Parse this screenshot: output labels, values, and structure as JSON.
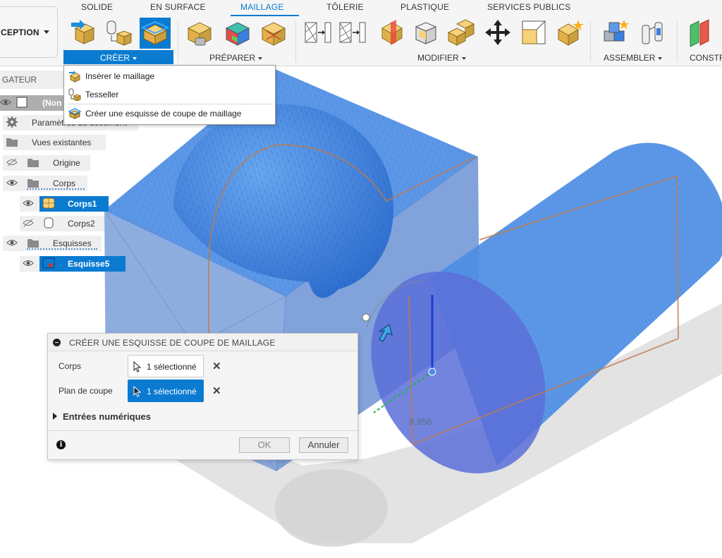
{
  "ribbon": {
    "workspace": {
      "label": "CEPTION"
    },
    "tabs": [
      {
        "label": "SOLIDE",
        "active": false
      },
      {
        "label": "EN SURFACE",
        "active": false
      },
      {
        "label": "MAILLAGE",
        "active": true
      },
      {
        "label": "TÔLERIE",
        "active": false
      },
      {
        "label": "PLASTIQUE",
        "active": false
      },
      {
        "label": "SERVICES PUBLICS",
        "active": false
      }
    ],
    "groups": {
      "creer": "CRÉER",
      "preparer": "PRÉPARER",
      "modifier": "MODIFIER",
      "assembler": "ASSEMBLER",
      "construire": "CONSTR"
    },
    "accent_color": "#0a7bd1"
  },
  "creer_menu": {
    "items": [
      {
        "label": "Insérer le maillage",
        "icon": "insert-mesh-icon"
      },
      {
        "label": "Tesseller",
        "icon": "tessellate-icon"
      },
      {
        "label": "Créer une esquisse de coupe de maillage",
        "icon": "mesh-section-sketch-icon"
      }
    ]
  },
  "browser": {
    "header": "GATEUR",
    "root": "(Non",
    "items": [
      {
        "label": "Paramètres du document",
        "icon": "gear-icon"
      },
      {
        "label": "Vues existantes",
        "icon": "folder-icon"
      },
      {
        "label": "Origine",
        "icon": "folder-icon"
      },
      {
        "label": "Corps",
        "icon": "folder-icon"
      },
      {
        "label": "Corps1",
        "icon": "mesh-body-icon",
        "selected": true
      },
      {
        "label": "Corps2",
        "icon": "body-icon"
      },
      {
        "label": "Esquisses",
        "icon": "folder-icon"
      },
      {
        "label": "Esquisse5",
        "icon": "sketch-icon",
        "selected": true
      }
    ]
  },
  "dialog": {
    "title": "CRÉER UNE ESQUISSE DE COUPE DE MAILLAGE",
    "corps_label": "Corps",
    "corps_value": "1 sélectionné",
    "plan_label": "Plan de coupe",
    "plan_value": "1 sélectionné",
    "entrees_label": "Entrées numériques",
    "ok_label": "OK",
    "cancel_label": "Annuler"
  },
  "viewport": {
    "dimension_label": "8,958"
  }
}
